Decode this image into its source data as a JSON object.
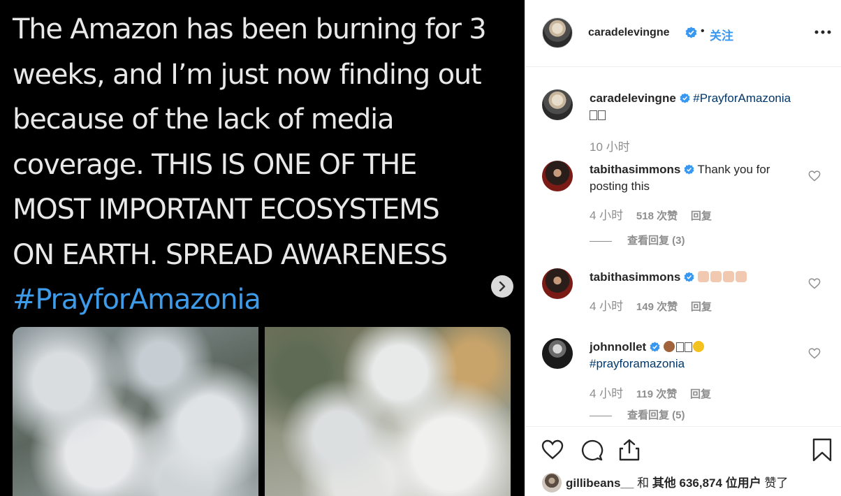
{
  "media": {
    "tweet_lines": [
      "The Amazon has been burning for 3",
      "weeks, and I’m just now finding out",
      "because of the lack of media",
      "coverage. THIS IS ONE OF THE",
      "MOST IMPORTANT ECOSYSTEMS",
      "ON EARTH. SPREAD AWARENESS"
    ],
    "tweet_hashtag": "#PrayforAmazonia"
  },
  "header": {
    "username": "caradelevingne",
    "dot": "•",
    "follow_label": "关注"
  },
  "caption": {
    "username": "caradelevingne",
    "hashtag": "#PrayforAmazonia",
    "time": "10 小时"
  },
  "comments": [
    {
      "username": "tabithasimmons",
      "text": "Thank you for posting this",
      "time": "4 小时",
      "likes": "518 次赞",
      "reply": "回复",
      "view_replies": "查看回复 (3)"
    },
    {
      "username": "tabithasimmons",
      "text": "",
      "time": "4 小时",
      "likes": "149 次赞",
      "reply": "回复"
    },
    {
      "username": "johnnollet",
      "hashtag": "#prayforamazonia",
      "time": "4 小时",
      "likes": "119 次赞",
      "reply": "回复",
      "view_replies": "查看回复 (5)"
    }
  ],
  "likes_summary": {
    "user": "gillibeans__",
    "and": "和",
    "others": "其他 636,874 位用户",
    "liked": "赞了"
  },
  "colors": {
    "accent": "#3897f0",
    "hashtag": "#00376b",
    "verified": "#3897f0",
    "muted": "#8e8e8e"
  }
}
